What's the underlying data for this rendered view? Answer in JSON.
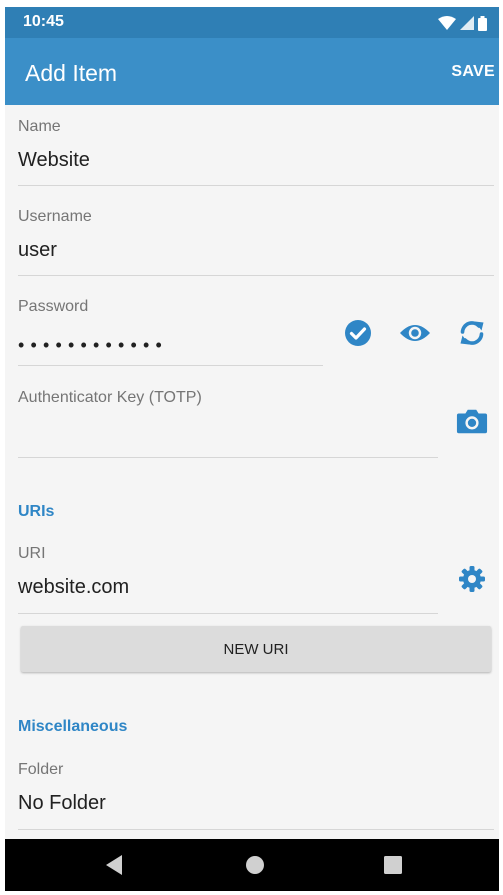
{
  "status_bar": {
    "time": "10:45"
  },
  "app_bar": {
    "title": "Add Item",
    "save_label": "SAVE"
  },
  "fields": {
    "name": {
      "label": "Name",
      "value": "Website"
    },
    "username": {
      "label": "Username",
      "value": "user"
    },
    "password": {
      "label": "Password",
      "value": "••••••••••••"
    },
    "totp": {
      "label": "Authenticator Key (TOTP)",
      "value": ""
    }
  },
  "uris_section": {
    "title": "URIs",
    "uri_label": "URI",
    "uri_value": "website.com",
    "new_uri_label": "NEW URI"
  },
  "misc_section": {
    "title": "Miscellaneous",
    "folder_label": "Folder",
    "folder_value": "No Folder"
  },
  "icons": {
    "check_password": "check-circle-icon",
    "toggle_visibility": "eye-icon",
    "generate_password": "refresh-icon",
    "scan_totp": "camera-icon",
    "uri_options": "gear-icon",
    "nav_back": "back-triangle-icon",
    "nav_home": "home-circle-icon",
    "nav_recents": "recents-square-icon"
  },
  "colors": {
    "status_bar": "#2f7fb5",
    "app_bar": "#3b8fc8",
    "accent": "#2f86c6",
    "background": "#f5f5f5",
    "button": "#dcdcdc"
  }
}
